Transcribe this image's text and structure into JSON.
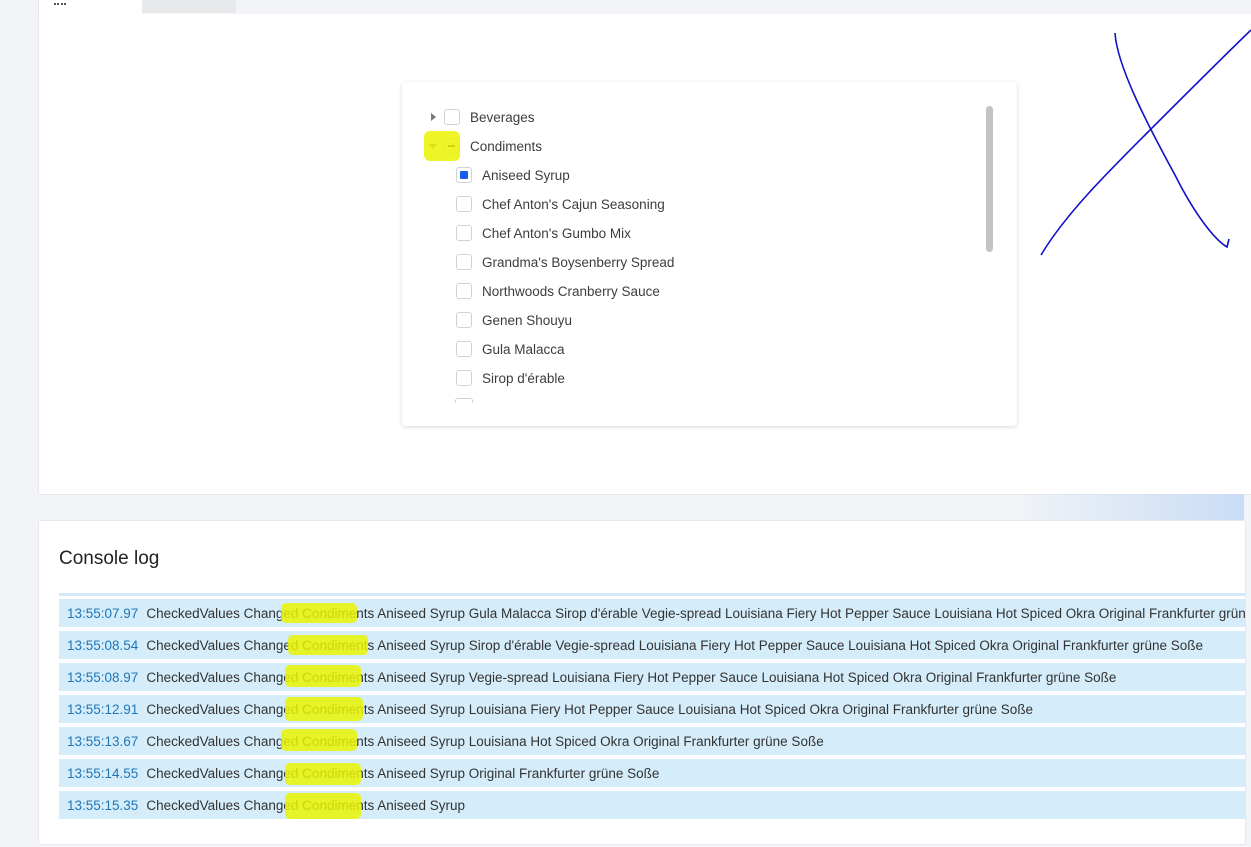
{
  "tabs": [
    {
      "label": ""
    },
    {
      "label": ""
    }
  ],
  "tree": {
    "nodes": [
      {
        "label": "Beverages",
        "state": "unchecked",
        "expander": "collapsed"
      },
      {
        "label": "Condiments",
        "state": "indeterminate",
        "expander": "expanded"
      },
      {
        "label": "Aniseed Syrup",
        "state": "checked"
      },
      {
        "label": "Chef Anton's Cajun Seasoning",
        "state": "unchecked"
      },
      {
        "label": "Chef Anton's Gumbo Mix",
        "state": "unchecked"
      },
      {
        "label": "Grandma's Boysenberry Spread",
        "state": "unchecked"
      },
      {
        "label": "Northwoods Cranberry Sauce",
        "state": "unchecked"
      },
      {
        "label": "Genen Shouyu",
        "state": "unchecked"
      },
      {
        "label": "Gula Malacca",
        "state": "unchecked"
      },
      {
        "label": "Sirop d'érable",
        "state": "unchecked"
      }
    ]
  },
  "console": {
    "title": "Console log",
    "rows": [
      {
        "time": "13:55:07.97",
        "message": "CheckedValues Changed Condiments Aniseed Syrup Gula Malacca Sirop d'érable Vegie-spread Louisiana Fiery Hot Pepper Sauce Louisiana Hot Spiced Okra Original Frankfurter grüne Soße"
      },
      {
        "time": "13:55:08.54",
        "message": "CheckedValues Changed Condiments Aniseed Syrup Sirop d'érable Vegie-spread Louisiana Fiery Hot Pepper Sauce Louisiana Hot Spiced Okra Original Frankfurter grüne Soße"
      },
      {
        "time": "13:55:08.97",
        "message": "CheckedValues Changed Condiments Aniseed Syrup Vegie-spread Louisiana Fiery Hot Pepper Sauce Louisiana Hot Spiced Okra Original Frankfurter grüne Soße"
      },
      {
        "time": "13:55:12.91",
        "message": "CheckedValues Changed Condiments Aniseed Syrup Louisiana Fiery Hot Pepper Sauce Louisiana Hot Spiced Okra Original Frankfurter grüne Soße"
      },
      {
        "time": "13:55:13.67",
        "message": "CheckedValues Changed Condiments Aniseed Syrup Louisiana Hot Spiced Okra Original Frankfurter grüne Soße"
      },
      {
        "time": "13:55:14.55",
        "message": "CheckedValues Changed Condiments Aniseed Syrup Original Frankfurter grüne Soße"
      },
      {
        "time": "13:55:15.35",
        "message": "CheckedValues Changed Condiments Aniseed Syrup"
      }
    ]
  },
  "colors": {
    "highlight": "#ecf200",
    "annotation_stroke": "#1111cc",
    "checked_fill": "#1a5de8",
    "log_row_bg": "#d5edfa",
    "timestamp": "#2076b7"
  },
  "icons": [
    "tab-grid-icon",
    "expand-collapsed-icon",
    "expand-expanded-icon"
  ]
}
